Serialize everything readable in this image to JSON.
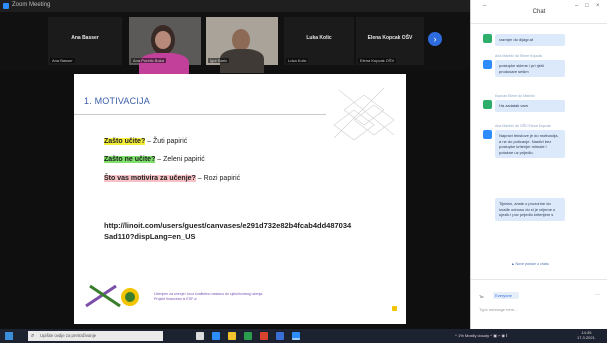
{
  "window": {
    "title": "Zoom Meeting"
  },
  "gallery": {
    "tiles": [
      {
        "name": "Ana Basser",
        "caption": "Ana Basser"
      },
      {
        "name": "",
        "caption": "Ana Puretic Boka"
      },
      {
        "name": "",
        "caption": "Igor Baric"
      },
      {
        "name": "Luka Kolic",
        "caption": "Luka Kolic"
      },
      {
        "name": "Elena Kopcak OŠV",
        "caption": "Elena Kopcak OŠV"
      }
    ],
    "next_icon": "›"
  },
  "chat": {
    "title": "Chat",
    "controls": {
      "minimize": "–",
      "maximize": "□",
      "close": "×"
    },
    "messages": [
      {
        "sender": "",
        "text": "razmjer do dijagr.at",
        "avatar": "green"
      },
      {
        "sender": "Ana Marinić do Elene Kopcak",
        "text": "postupke sklene i pri rješi produsare sešim",
        "avatar": "blue"
      },
      {
        "sender": "Kopcak Elene do Marinić",
        "text": "Ha zadatak vam",
        "avatar": "green"
      },
      {
        "sender": "Ana Marinić do OŠV Elena Kopcak",
        "text": "Napravi tekstove je do motivacija, a ne do poticanje. Nastivi bez postupke kriterijer mimale i potakne uz prijedlo.",
        "avatar": "blue"
      },
      {
        "sender": "",
        "text": "Tijedan, znate u prozorine do izrađe odnosu do sl je vrijeme u ujezik i pov prijedlo kriterijem s",
        "avatar": "blue"
      }
    ],
    "new_messages": "▲ Nove poruke u chatu",
    "footer": {
      "to_label": "To:",
      "to_value": "Everyone",
      "placeholder": "Type message here...",
      "icons": "⋯"
    }
  },
  "slide": {
    "heading": "1. MOTIVACIJA",
    "lines": [
      {
        "highlight": "Zašto učite?",
        "rest": " – Žuti papirić",
        "color": "yellow"
      },
      {
        "highlight": "Zašto ne učite?",
        "rest": " – Zeleni papirić",
        "color": "green"
      },
      {
        "highlight": "Što vas motivira za učenje?",
        "rest": " – Rozi papirić",
        "color": "pink"
      }
    ],
    "url": "http://linoit.com/users/guest/canvases/e291d732e82b4fcab4dd487034Sad110?dispLang=en_US",
    "caption": "Učenjem za učenje i kroz kvalitetnu nastavu do cjeloživotnog učenja. Projekt financiran iz ESF-a"
  },
  "taskbar": {
    "search_placeholder": "Upišite ovdje za pretraživanje",
    "tray": "^ 1% Mostly cloudy ^ ▣ ⌐ ◉ 𝄃",
    "time": "14:35",
    "date": "17.3.2021."
  },
  "colors": {
    "accent": "#2d8cff",
    "slide_title": "#3a5ea8",
    "highlight_yellow": "#f5ee3b",
    "highlight_green": "#7ee06a",
    "highlight_pink": "#f7c1c6"
  }
}
